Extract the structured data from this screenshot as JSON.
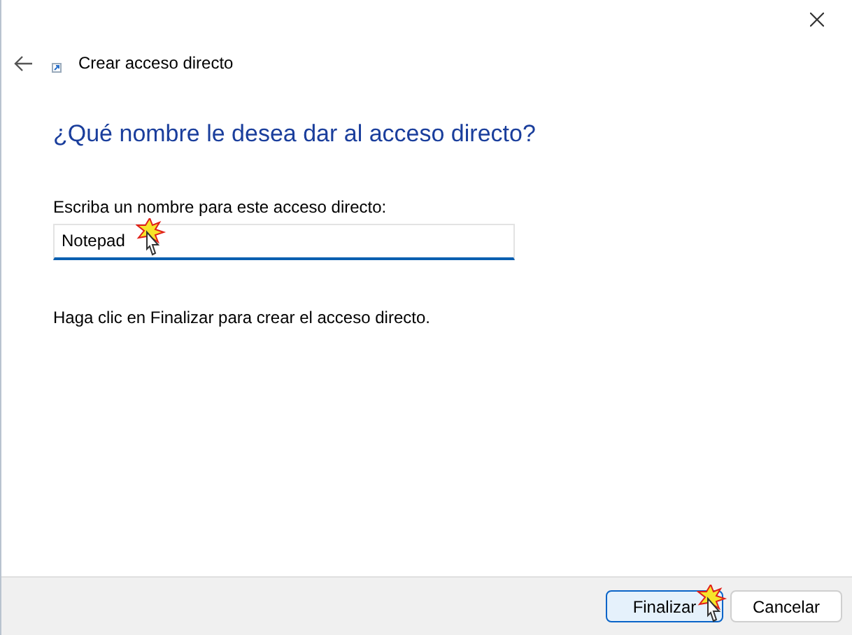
{
  "window": {
    "title": "Crear acceso directo"
  },
  "heading": "¿Qué nombre le desea dar al acceso directo?",
  "name_field": {
    "label": "Escriba un nombre para este acceso directo:",
    "value": "Notepad"
  },
  "instruction": "Haga clic en Finalizar para crear el acceso directo.",
  "buttons": [
    {
      "label": "Finalizar",
      "default": true
    },
    {
      "label": "Cancelar",
      "default": false
    }
  ]
}
